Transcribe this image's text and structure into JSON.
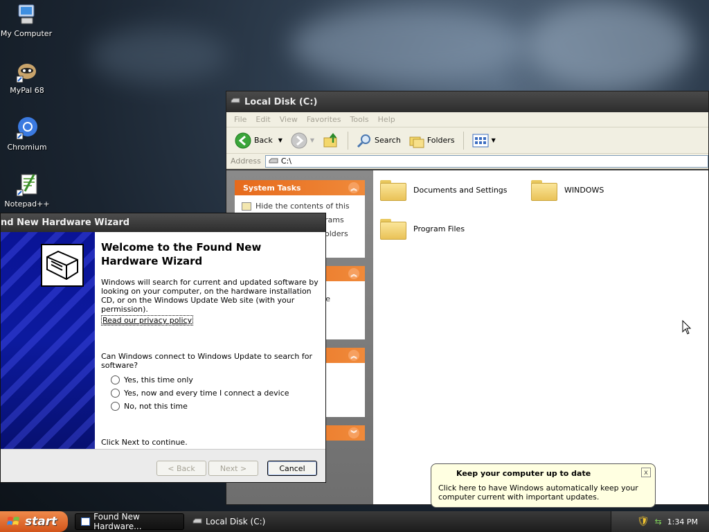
{
  "desktop": {
    "icons": [
      {
        "label": "My Computer"
      },
      {
        "label": "MyPal 68"
      },
      {
        "label": "Chromium"
      },
      {
        "label": "Notepad++"
      }
    ]
  },
  "explorer": {
    "title": "Local Disk (C:)",
    "menu": [
      "File",
      "Edit",
      "View",
      "Favorites",
      "Tools",
      "Help"
    ],
    "toolbar": {
      "back": "Back",
      "search": "Search",
      "folders": "Folders"
    },
    "address": {
      "label": "Address",
      "value": "C:\\"
    },
    "taskpane": {
      "system_tasks": "System Tasks",
      "item1": "Hide the contents of this",
      "item2": "rams",
      "item3": "olders",
      "item4": "the"
    },
    "folders": [
      "Documents and Settings",
      "WINDOWS",
      "Program Files"
    ]
  },
  "wizard": {
    "title": "nd New Hardware Wizard",
    "heading": "Welcome to the Found New Hardware Wizard",
    "intro": "Windows will search for current and updated software by looking on your computer, on the hardware installation CD, or on the Windows Update Web site (with your permission).",
    "privacy_link": "Read our privacy policy",
    "question": "Can Windows connect to Windows Update to search for software?",
    "options": [
      "Yes, this time only",
      "Yes, now and every time I connect a device",
      "No, not this time"
    ],
    "continue_text": "Click Next to continue.",
    "buttons": {
      "back": "< Back",
      "next": "Next >",
      "cancel": "Cancel"
    }
  },
  "balloon": {
    "title": "Keep your computer up to date",
    "message": "Click here to have Windows automatically keep your computer current with important updates.",
    "close": "x"
  },
  "taskbar": {
    "start": "start",
    "tasks": [
      "Found New Hardware...",
      "Local Disk (C:)"
    ],
    "clock": "1:34 PM"
  },
  "colors": {
    "accent_orange": "#e66a1c",
    "wizard_blue": "#0a1396",
    "balloon_bg": "#ffffe1"
  }
}
